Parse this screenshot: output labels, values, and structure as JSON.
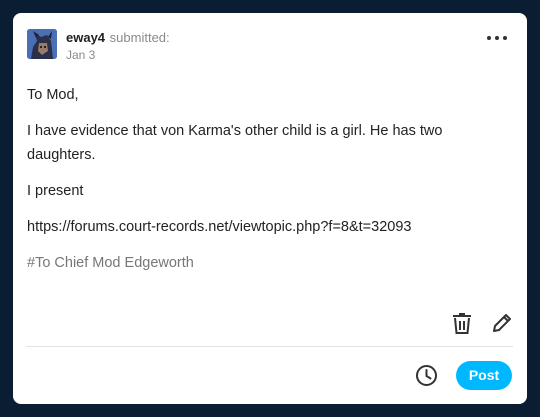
{
  "post": {
    "username": "eway4",
    "submitted_label": "submitted:",
    "date": "Jan 3",
    "paragraphs": [
      "To Mod,",
      "I have evidence that von Karma's other child is a girl. He has two daughters.",
      "I present",
      "https://forums.court-records.net/viewtopic.php?f=8&t=32093"
    ],
    "tag": "#To Chief Mod Edgeworth"
  },
  "actions": {
    "post_label": "Post",
    "delete_icon": "trash-icon",
    "edit_icon": "pencil-icon",
    "schedule_icon": "clock-icon",
    "more_icon": "ellipsis-icon"
  },
  "colors": {
    "background": "#0b1d33",
    "card": "#ffffff",
    "accent": "#00b8ff"
  }
}
